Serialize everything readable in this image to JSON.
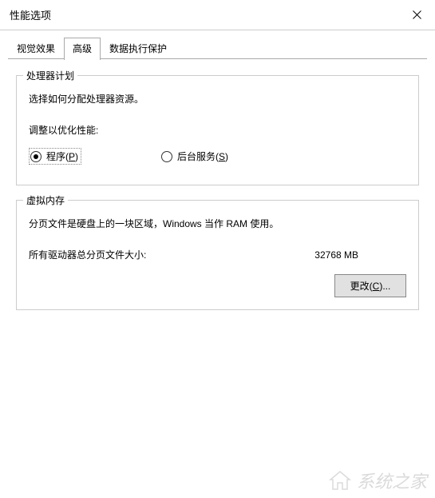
{
  "window": {
    "title": "性能选项"
  },
  "tabs": {
    "visual_effects": "视觉效果",
    "advanced": "高级",
    "dep": "数据执行保护"
  },
  "processor": {
    "group_title": "处理器计划",
    "desc": "选择如何分配处理器资源。",
    "adjust_label": "调整以优化性能:",
    "programs_label": "程序(",
    "programs_hotkey": "P",
    "programs_suffix": ")",
    "bgservices_label": "后台服务(",
    "bgservices_hotkey": "S",
    "bgservices_suffix": ")"
  },
  "vm": {
    "group_title": "虚拟内存",
    "desc": "分页文件是硬盘上的一块区域，Windows 当作 RAM 使用。",
    "total_label": "所有驱动器总分页文件大小:",
    "total_value": "32768 MB",
    "change_label": "更改(",
    "change_hotkey": "C",
    "change_suffix": ")..."
  },
  "watermark": {
    "text": "系统之家"
  }
}
